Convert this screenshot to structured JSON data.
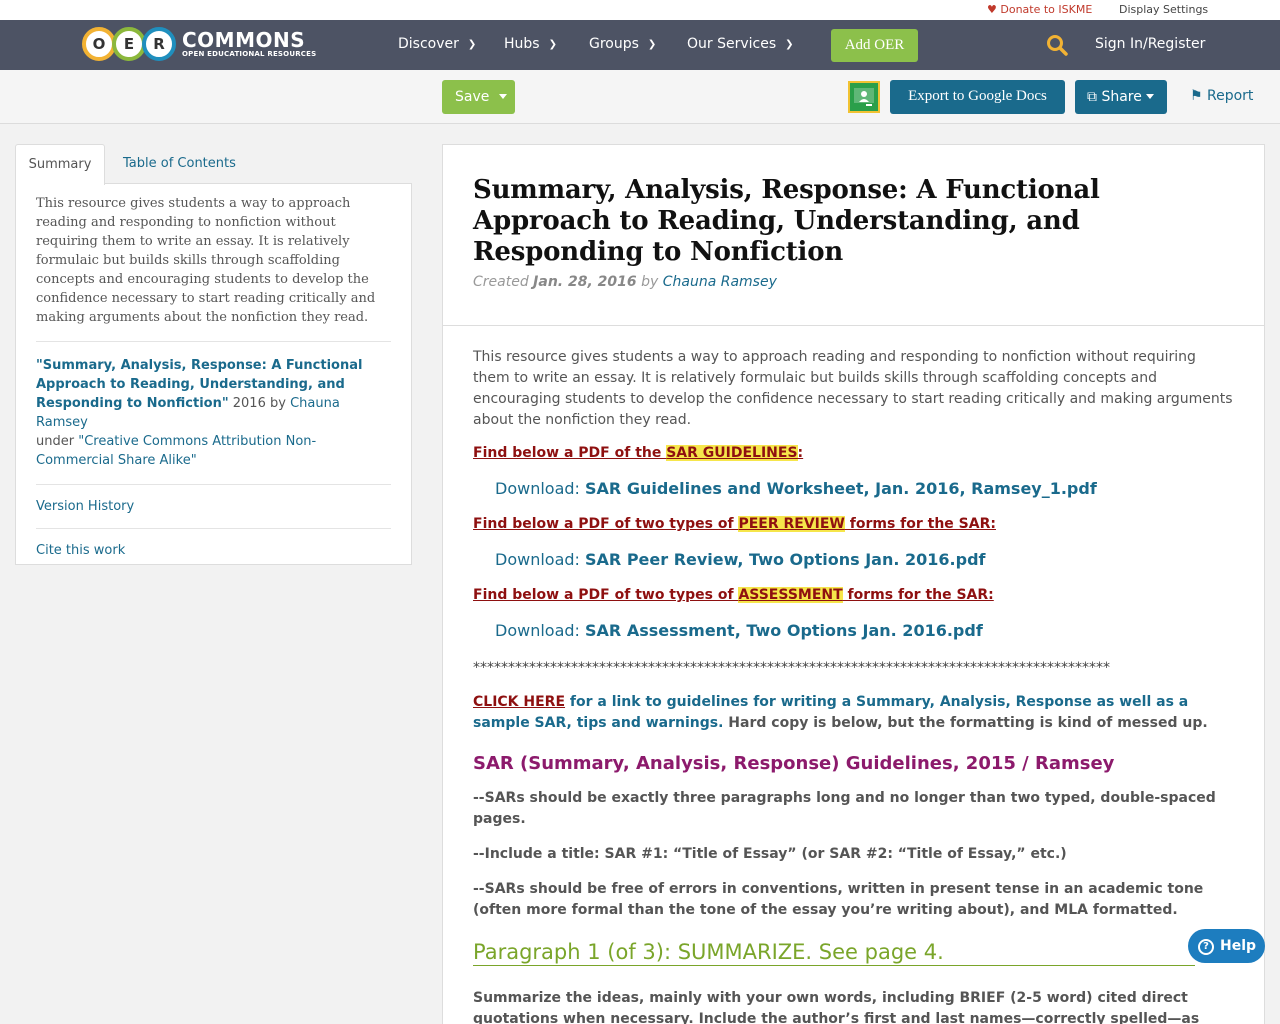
{
  "utility": {
    "donate": "Donate to ISKME",
    "display_settings": "Display Settings"
  },
  "header": {
    "logo_letters": [
      "O",
      "E",
      "R"
    ],
    "logo_brand": "COMMONS",
    "logo_tagline": "OPEN EDUCATIONAL RESOURCES",
    "nav": [
      "Discover",
      "Hubs",
      "Groups",
      "Our Services"
    ],
    "add_oer": "Add OER",
    "sign_in": "Sign In/Register"
  },
  "toolbar": {
    "save": "Save",
    "export": "Export to Google Docs",
    "share": "Share",
    "report": "Report"
  },
  "sidebar": {
    "tabs": [
      "Summary",
      "Table of Contents"
    ],
    "description": "This resource gives students a way to approach reading and responding to nonfiction without requiring them to write an essay. It is relatively formulaic but builds skills through scaffolding concepts and encouraging students to develop the confidence necessary to start reading critically and making arguments about the nonfiction they read.",
    "attribution_title": "\"Summary, Analysis, Response: A Functional Approach to Reading, Understanding, and Responding to Nonfiction\"",
    "attribution_year_by": " 2016 by ",
    "attribution_author": "Chauna Ramsey",
    "attribution_under": "under ",
    "attribution_license": "\"Creative Commons Attribution Non-Commercial Share Alike\"",
    "version_history": "Version History",
    "cite": "Cite this work"
  },
  "main": {
    "title": "Summary, Analysis, Response: A Functional Approach to Reading, Understanding, and Responding to Nonfiction",
    "created_label": "Created ",
    "created_date": "Jan. 28, 2016",
    "by": " by ",
    "author": "Chauna Ramsey",
    "intro": "This resource gives students a way to approach reading and responding to nonfiction without requiring them to write an essay. It is relatively formulaic but builds skills through scaffolding concepts and encouraging students to develop the confidence necessary to start reading critically and making arguments about the nonfiction they read.",
    "section1_pre": "Find below a PDF of the ",
    "section1_hl": "SAR GUIDELINES",
    "section1_post": ":",
    "download_label": "Download: ",
    "file1": "SAR Guidelines and Worksheet, Jan. 2016, Ramsey_1.pdf",
    "section2_pre": "Find below a PDF of two types of ",
    "section2_hl": "PEER REVIEW",
    "section2_post": " forms for the SAR: ",
    "file2": "SAR Peer Review, Two Options Jan. 2016.pdf",
    "section3_pre": "Find below a PDF of two types of ",
    "section3_hl": "ASSESSMENT",
    "section3_post": " forms for the SAR: ",
    "file3": "SAR Assessment, Two Options Jan. 2016.pdf",
    "stars": "*******************************************************************************************",
    "click_here": "CLICK HERE",
    "click_text": " for a link to guidelines for writing a Summary, Analysis, Response as well as a sample SAR, tips and warnings.",
    "click_rest": " Hard copy is below, but the formatting is kind of messed up.",
    "sar_title": "SAR (Summary, Analysis, Response) Guidelines,  2015 / Ramsey",
    "rule1": "--SARs should be exactly three paragraphs long and no longer than two typed, double-spaced pages.",
    "rule2": "--Include a title:  SAR #1: “Title of Essay” (or SAR #2: “Title of Essay,” etc.)",
    "rule3": "--SARs should be free of errors in conventions, written in present tense in an academic tone (often more formal than the tone of the essay you’re writing about), and MLA formatted.",
    "para1_heading": "Paragraph 1 (of 3): SUMMARIZE.   See page 4.",
    "summarize_text": "Summarize the ideas, mainly with your own words, including BRIEF (2-5 word) cited direct quotations when necessary. Include the author’s first and last names—correctly spelled—as well as the essay title in your first sentence. This should be about one-third of the SAR."
  },
  "help": "Help",
  "colors": {
    "header_bg": "#4d5364",
    "accent_green": "#8cc04b",
    "link_blue": "#1a6a8c",
    "highlight": "#f6e64b",
    "dark_red": "#8e1010"
  }
}
